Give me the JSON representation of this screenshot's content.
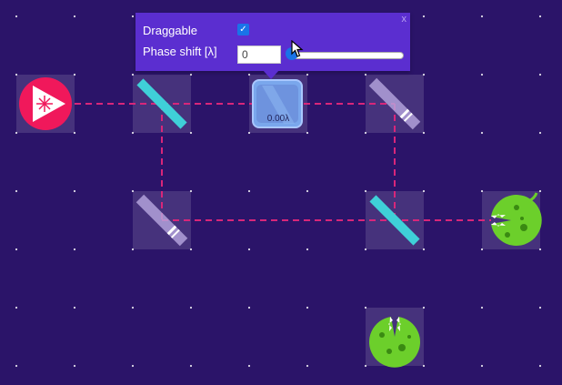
{
  "tooltip": {
    "draggable_label": "Draggable",
    "draggable_checked": true,
    "phase_label": "Phase shift [λ]",
    "phase_value": "0",
    "phase_fraction": 0,
    "close_label": "x"
  },
  "board": {
    "glass_label": "0.00λ"
  },
  "colors": {
    "background": "#2b1469",
    "beam": "#d8267a",
    "laser": "#f0185b",
    "mirror": "#3fd0d8",
    "beam_splitter": "#d8c9f5",
    "detector": "#6ccf2b",
    "popup": "#5b2ed0"
  }
}
